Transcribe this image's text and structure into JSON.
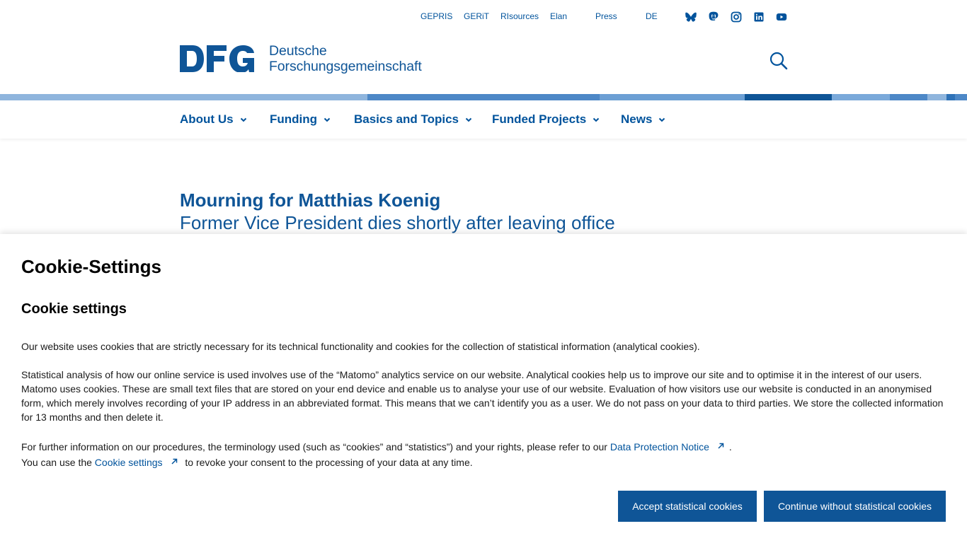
{
  "top_links": [
    "GEPRIS",
    "GERiT",
    "RIsources",
    "Elan",
    "Press",
    "DE"
  ],
  "social_icons": [
    "bluesky-icon",
    "mastodon-icon",
    "instagram-icon",
    "linkedin-icon",
    "youtube-icon"
  ],
  "logo": {
    "mark": "DFG",
    "line1": "Deutsche",
    "line2": "Forschungsgemeinschaft"
  },
  "nav": [
    "About Us",
    "Funding",
    "Basics and Topics",
    "Funded Projects",
    "News"
  ],
  "article": {
    "title": "Mourning for Matthias Koenig",
    "subtitle": "Former Vice President dies shortly after leaving office"
  },
  "cookie": {
    "heading": "Cookie-Settings",
    "subheading": "Cookie settings",
    "para1": "Our website uses cookies that are strictly necessary for its technical functionality and cookies for the collection of statistical information (analytical cookies).",
    "para2": "Statistical analysis of how our online service is used involves use of the “Matomo” analytics service on our website. Analytical cookies help us to improve our site and to optimise it in the interest of our users. Matomo uses cookies. These are small text files that are stored on your end device and enable us to analyse your use of our website. Evaluation of how visitors use our website is conducted in an anonymised form, which merely involves recording of your IP address in an abbreviated format. This means that we can’t identify you as a user. We do not pass on your data to third parties. We store the collected information for 13 months and then delete it.",
    "para3_pre": "For further information on our procedures, the terminology used (such as “cookies” and “statistics”) and your rights, please refer to our",
    "para3_link": "Data Protection Notice",
    "para3_post": ".",
    "para4_pre": "You can use the",
    "para4_link": "Cookie settings",
    "para4_post": "to revoke your consent to the processing of your data at any time.",
    "accept_label": "Accept statistical cookies",
    "continue_label": "Continue without statistical cookies"
  },
  "colors": {
    "brand": "#0f5597",
    "link": "#00539c",
    "stripe": [
      "#8fb5dd",
      "#4d88c7",
      "#0f5597"
    ]
  }
}
